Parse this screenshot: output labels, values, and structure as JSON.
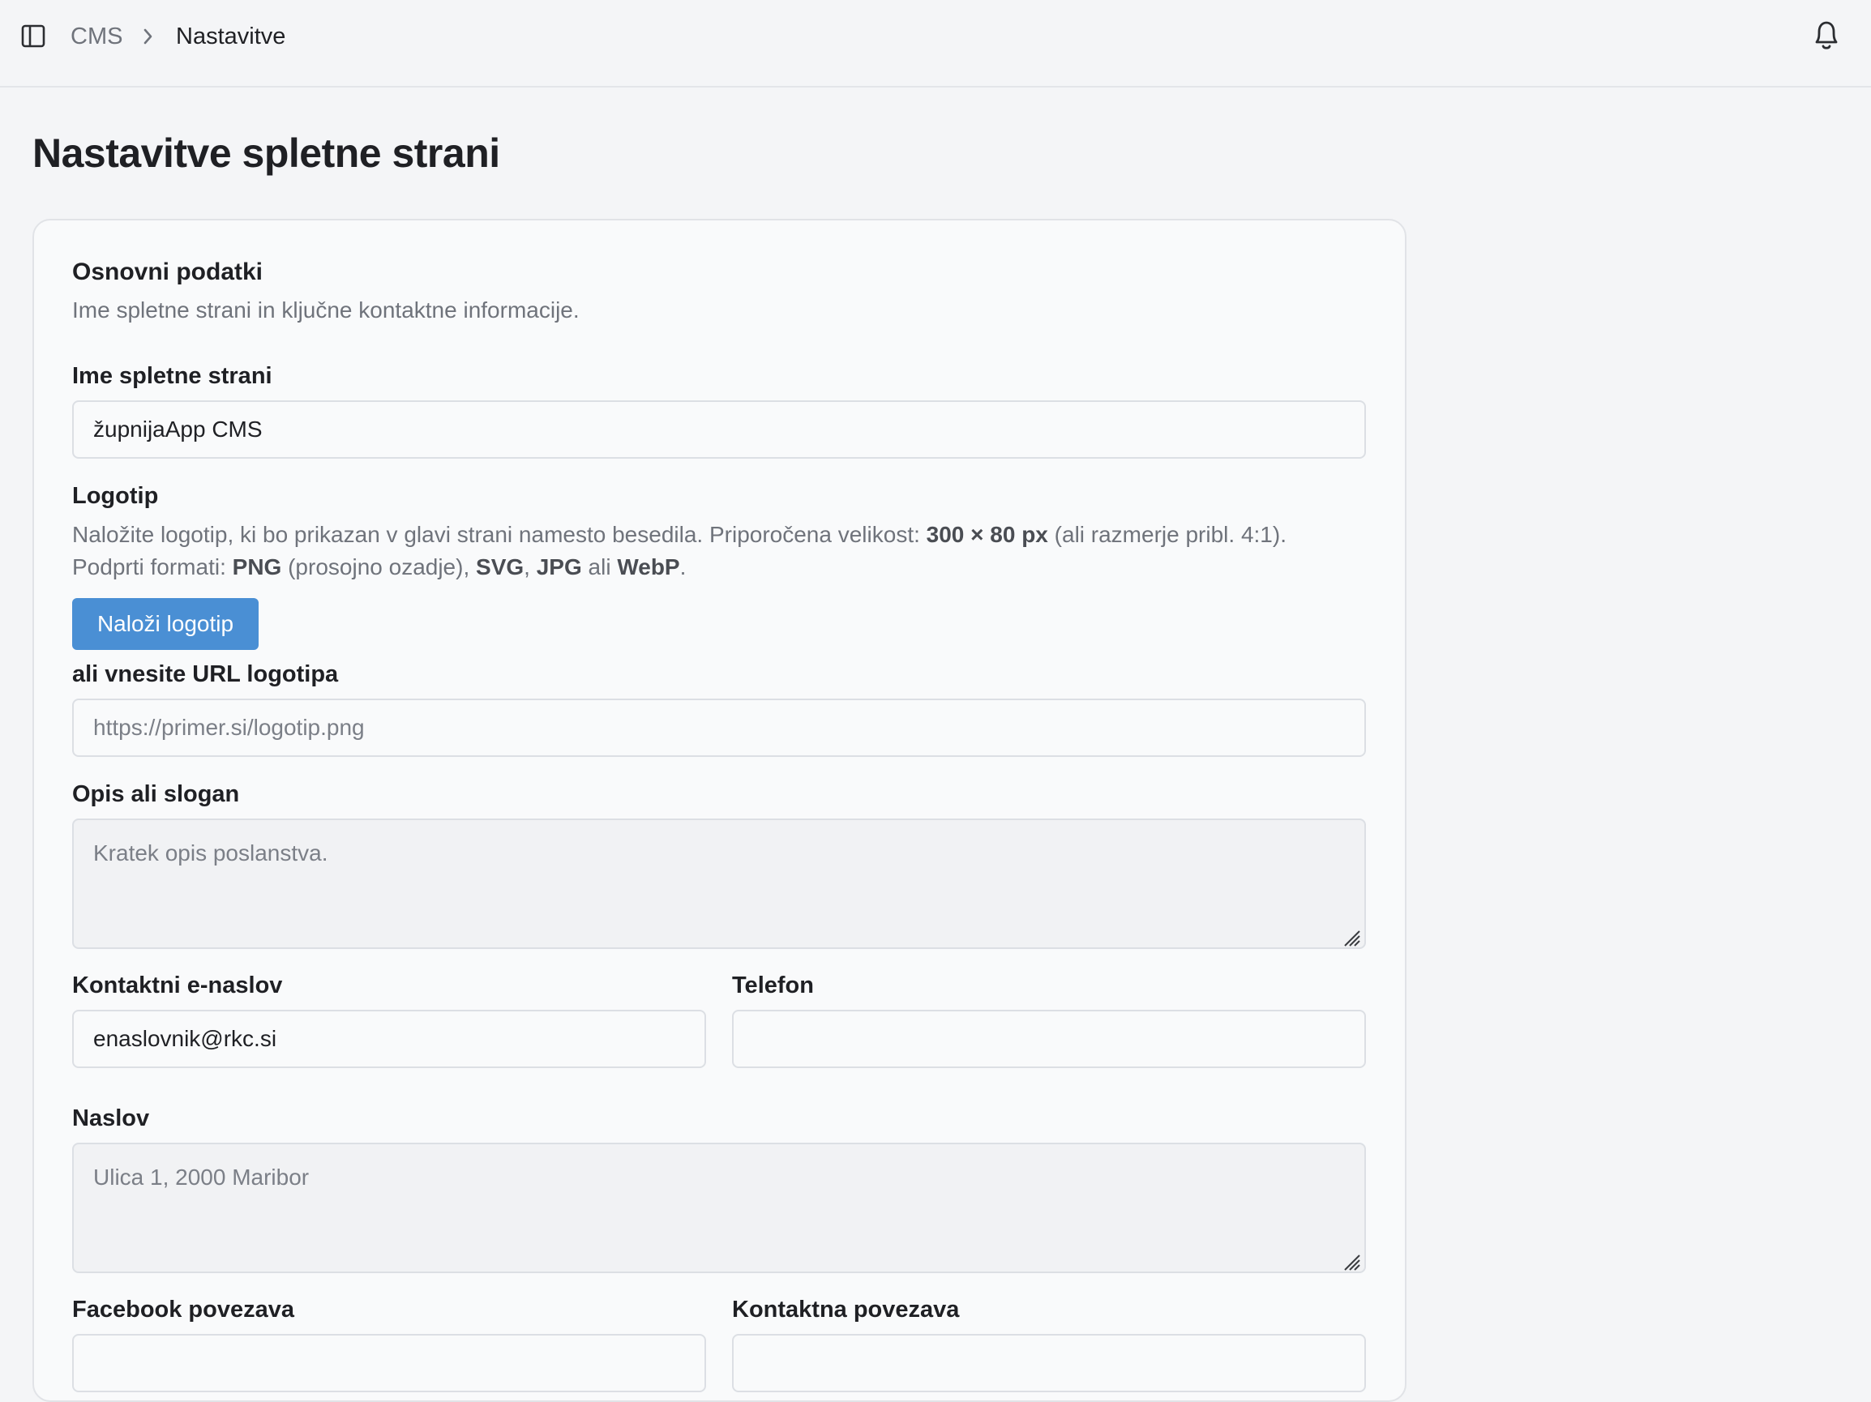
{
  "breadcrumb": {
    "root": "CMS",
    "current": "Nastavitve"
  },
  "page": {
    "title": "Nastavitve spletne strani"
  },
  "section": {
    "title": "Osnovni podatki",
    "description": "Ime spletne strani in ključne kontaktne informacije."
  },
  "fields": {
    "site_name": {
      "label": "Ime spletne strani",
      "value": "župnijaApp CMS"
    },
    "logo": {
      "label": "Logotip",
      "help_1": "Naložite logotip, ki bo prikazan v glavi strani namesto besedila. Priporočena velikost: ",
      "help_size": "300 × 80 px",
      "help_2": " (ali razmerje pribl. 4:1).",
      "help_3": "Podprti formati: ",
      "fmt_png": "PNG",
      "help_4": " (prosojno ozadje), ",
      "fmt_svg": "SVG",
      "help_5": ", ",
      "fmt_jpg": "JPG",
      "help_6": " ali ",
      "fmt_webp": "WebP",
      "help_7": ".",
      "upload_label": "Naloži logotip"
    },
    "logo_url": {
      "label": "ali vnesite URL logotipa",
      "placeholder": "https://primer.si/logotip.png"
    },
    "tagline": {
      "label": "Opis ali slogan",
      "placeholder": "Kratek opis poslanstva."
    },
    "email": {
      "label": "Kontaktni e-naslov",
      "value": "enaslovnik@rkc.si"
    },
    "phone": {
      "label": "Telefon",
      "value": ""
    },
    "address": {
      "label": "Naslov",
      "placeholder": "Ulica 1, 2000 Maribor"
    },
    "facebook": {
      "label": "Facebook povezava"
    },
    "contact_link": {
      "label": "Kontaktna povezava"
    }
  },
  "icons": {
    "sidebar": "sidebar-toggle-icon",
    "separator": "chevron-right-icon",
    "notifications": "bell-icon"
  },
  "colors": {
    "primary_button": "#4a8fd4",
    "background": "#f4f5f7"
  }
}
